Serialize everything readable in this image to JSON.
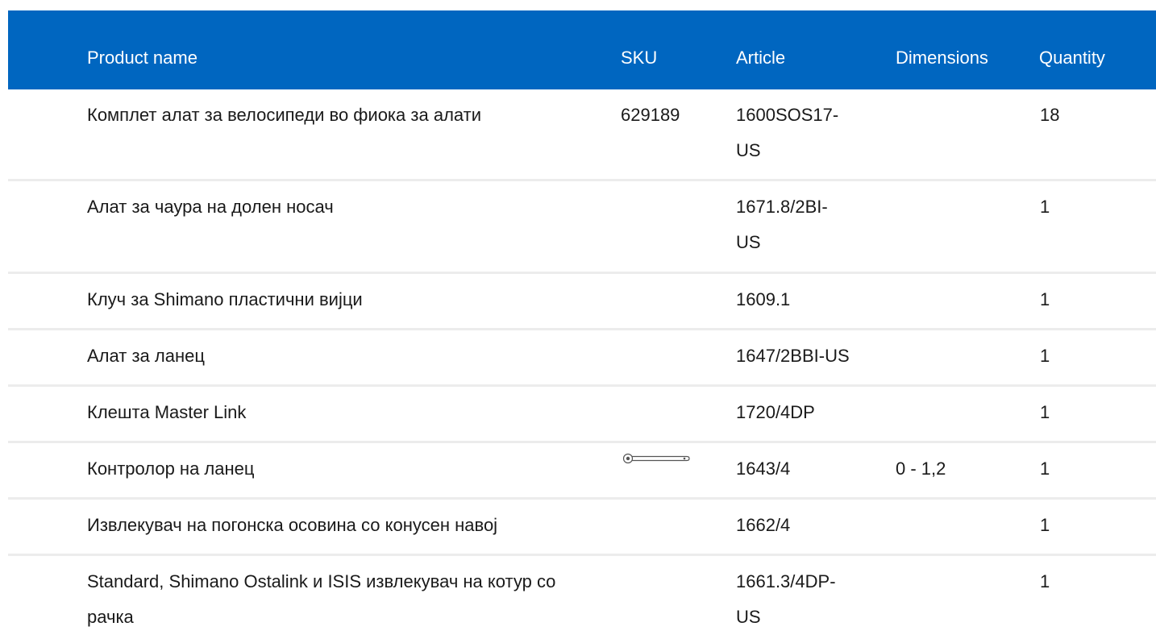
{
  "table": {
    "headers": {
      "name": "Product name",
      "sku": "SKU",
      "article": "Article",
      "dimensions": "Dimensions",
      "quantity": "Quantity"
    },
    "rows": [
      {
        "name": "Комплет алат за велосипеди во фиока за алати",
        "sku": "629189",
        "article": "1600SOS17-US",
        "dimensions": "",
        "quantity": "18"
      },
      {
        "name": "Алат за чаура на долен носач",
        "sku": "",
        "article": "1671.8/2BI-US",
        "dimensions": "",
        "quantity": "1"
      },
      {
        "name": "Клуч за Shimano пластични вијци",
        "sku": "",
        "article": "1609.1",
        "dimensions": "",
        "quantity": "1"
      },
      {
        "name": "Алат за ланец",
        "sku": "",
        "article": "1647/2BBI-US",
        "dimensions": "",
        "quantity": "1"
      },
      {
        "name": "Клешта Master Link",
        "sku": "",
        "article": "1720/4DP",
        "dimensions": "",
        "quantity": "1"
      },
      {
        "name": "Контролор на ланец",
        "sku": "",
        "sku_icon": "chain-checker-tool-icon",
        "article": "1643/4",
        "dimensions": "0 - 1,2",
        "quantity": "1"
      },
      {
        "name": "Извлекувач на погонска осовина со конусен навој",
        "sku": "",
        "article": "1662/4",
        "dimensions": "",
        "quantity": "1"
      },
      {
        "name": "Standard, Shimano Ostalink и ISIS извлекувач на котур со рачка",
        "sku": "",
        "article": "1661.3/4DP-US",
        "dimensions": "",
        "quantity": "1"
      }
    ]
  },
  "colors": {
    "header_bg": "#0066c0",
    "header_text": "#ffffff",
    "row_divider": "#ececec"
  }
}
